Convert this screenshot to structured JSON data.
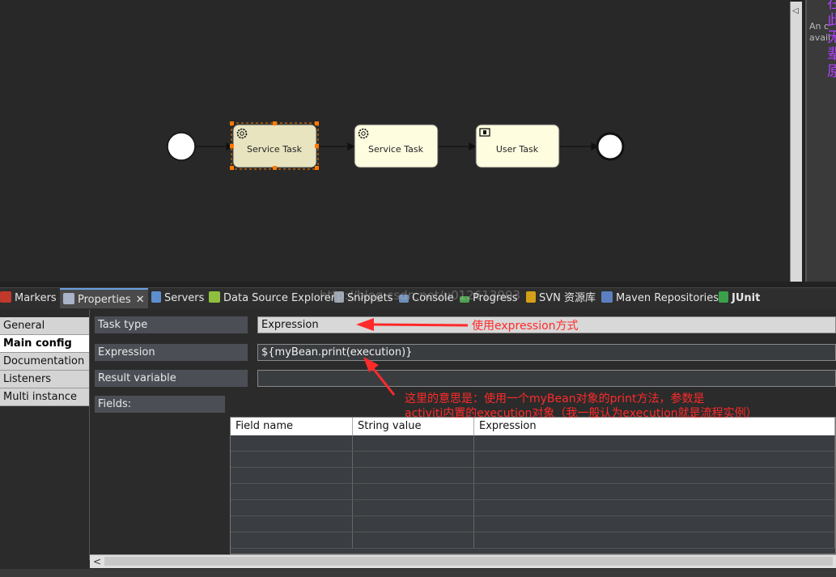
{
  "canvas": {
    "nodes": [
      {
        "type": "start-event"
      },
      {
        "type": "service-task",
        "label": "Service Task",
        "selected": true
      },
      {
        "type": "service-task",
        "label": "Service Task",
        "selected": false
      },
      {
        "type": "user-task",
        "label": "User Task",
        "selected": false
      },
      {
        "type": "end-event"
      }
    ],
    "side_panel_text": "An c\navail",
    "side_panel_chars": "在此无辈原"
  },
  "tabs": [
    {
      "label": "Markers",
      "icon": "markers-icon"
    },
    {
      "label": "Properties",
      "icon": "properties-icon",
      "active": true
    },
    {
      "label": "Servers",
      "icon": "servers-icon"
    },
    {
      "label": "Data Source Explorer",
      "icon": "data-source-icon"
    },
    {
      "label": "Snippets",
      "icon": "snippets-icon"
    },
    {
      "label": "Console",
      "icon": "console-icon"
    },
    {
      "label": "Progress",
      "icon": "progress-icon"
    },
    {
      "label": "SVN 资源库",
      "icon": "svn-icon"
    },
    {
      "label": "Maven Repositories",
      "icon": "maven-icon"
    },
    {
      "label": "JUnit",
      "icon": "junit-icon"
    }
  ],
  "nav": [
    "General",
    "Main config",
    "Documentation",
    "Listeners",
    "Multi instance"
  ],
  "form": {
    "task_type_label": "Task type",
    "task_type_value": "Expression",
    "expression_label": "Expression",
    "expression_value": "${myBean.print(execution)}",
    "result_variable_label": "Result variable",
    "result_variable_value": "",
    "fields_label": "Fields:"
  },
  "fields_table": {
    "columns": [
      "Field name",
      "String value",
      "Expression"
    ],
    "rows": 7
  },
  "annotations": {
    "a1": "使用expression方式",
    "a2_line1": "这里的意思是：使用一个myBean对象的print方法，参数是",
    "a2_line2": "activiti内置的execution对象（我一般认为execution就是流程实例）"
  },
  "watermark": "http://blog.csdn.net/u012613903",
  "colors": {
    "task_fill": "#fffde0",
    "selected_task_fill": "#e8e4c0",
    "selection_handle": "#ff7a00",
    "annotation": "#ff2a2a"
  }
}
